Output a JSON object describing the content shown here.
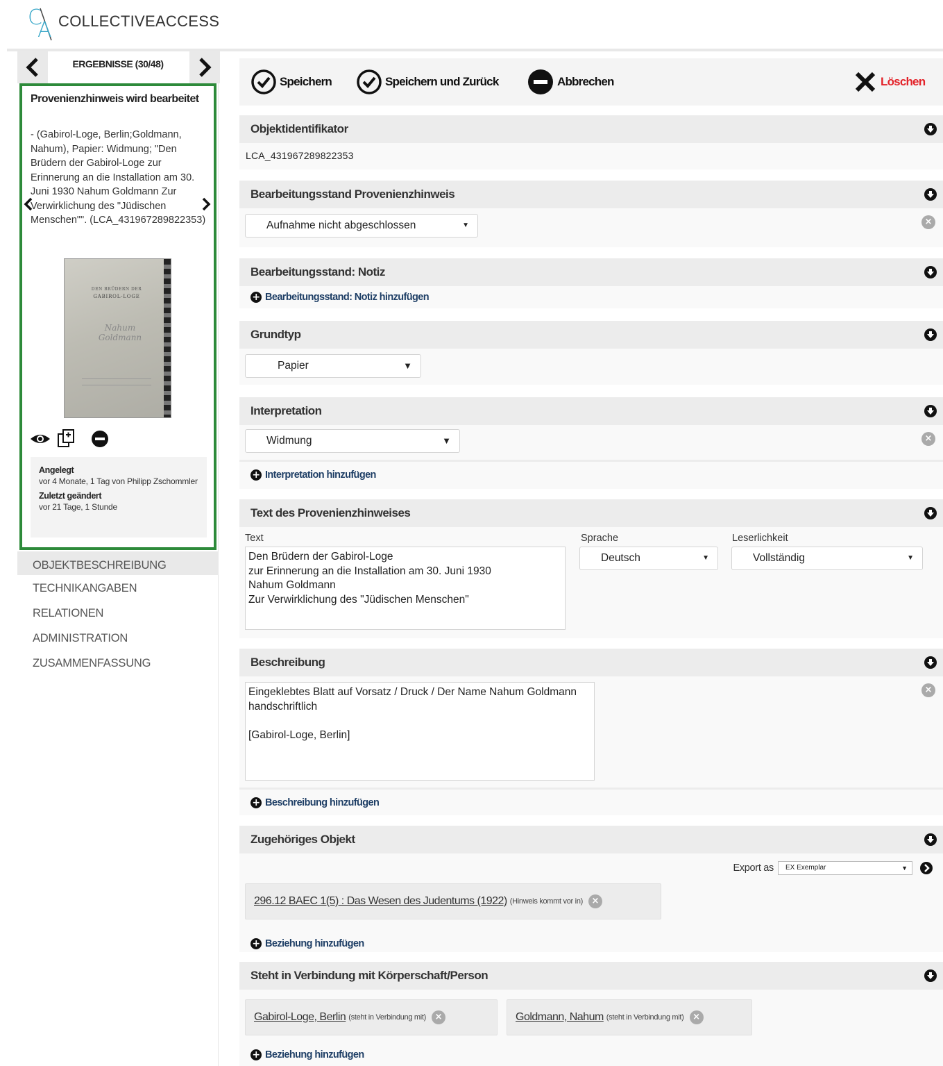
{
  "app": {
    "logo_text": "COLLECTIVEACCESS",
    "logo_c": "C",
    "logo_a": "A",
    "accent_color": "#3aa8c9"
  },
  "results": {
    "label": "ERGEBNISSE (30/48)",
    "prev_icon": "chevron-left-icon",
    "next_icon": "chevron-right-icon"
  },
  "inspector": {
    "title": "Provenienzhinweis wird bearbeitet",
    "description": "- (Gabirol-Loge, Berlin;Goldmann, Nahum), Papier: Widmung; \"Den Brüdern der Gabirol-Loge zur Erinnerung an die Installation am 30. Juni 1930 Nahum Goldmann Zur Verwirklichung des \"Jüdischen Menschen\"\". (LCA_431967289822353)",
    "border_color": "#2d8a3a",
    "thumbnail": {
      "line1": "DEN BRÜDERN DER",
      "line2": "GABIROL-LOGE",
      "signature": "Nahum Goldmann"
    },
    "created_label": "Angelegt",
    "created_value": "vor 4 Monate, 1 Tag von Philipp Zschommler",
    "modified_label": "Zuletzt geändert",
    "modified_value": "vor 21 Tage, 1 Stunde"
  },
  "side_menu": [
    {
      "label": "OBJEKTBESCHREIBUNG",
      "active": true
    },
    {
      "label": "TECHNIKANGABEN",
      "active": false
    },
    {
      "label": "RELATIONEN",
      "active": false
    },
    {
      "label": "ADMINISTRATION",
      "active": false
    },
    {
      "label": "ZUSAMMENFASSUNG",
      "active": false
    }
  ],
  "toolbar": {
    "save": "Speichern",
    "save_return": "Speichern und Zurück",
    "cancel": "Abbrechen",
    "delete": "Löschen",
    "delete_color": "#e3232a"
  },
  "sections": {
    "identifier": {
      "title": "Objektidentifikator",
      "value": "LCA_431967289822353"
    },
    "status": {
      "title": "Bearbeitungsstand Provenienzhinweis",
      "selected": "Aufnahme nicht abgeschlossen"
    },
    "status_note": {
      "title": "Bearbeitungsstand: Notiz",
      "add_label": "Bearbeitungsstand: Notiz hinzufügen"
    },
    "basic_type": {
      "title": "Grundtyp",
      "selected": "Papier"
    },
    "interpretation": {
      "title": "Interpretation",
      "selected": "Widmung",
      "add_label": "Interpretation hinzufügen"
    },
    "text": {
      "title": "Text des Provenienzhinweises",
      "text_label": "Text",
      "text_value": "Den Brüdern der Gabirol-Loge\nzur Erinnerung an die Installation am 30. Juni 1930\nNahum Goldmann\nZur Verwirklichung des \"Jüdischen Menschen\"",
      "language_label": "Sprache",
      "language_value": "Deutsch",
      "legibility_label": "Leserlichkeit",
      "legibility_value": "Vollständig"
    },
    "description": {
      "title": "Beschreibung",
      "value": "Eingeklebtes Blatt auf Vorsatz / Druck / Der Name Nahum Goldmann handschriftlich\n\n[Gabirol-Loge, Berlin]",
      "add_label": "Beschreibung hinzufügen"
    },
    "related_object": {
      "title": "Zugehöriges Objekt",
      "export_label": "Export as",
      "export_value": "EX Exemplar",
      "item_link": "296.12 BAEC 1(5) : Das Wesen des Judentums (1922)",
      "item_rel": "(Hinweis kommt vor in)",
      "add_label": "Beziehung hinzufügen"
    },
    "entity": {
      "title": "Steht in Verbindung mit Körperschaft/Person",
      "items": [
        {
          "link": "Gabirol-Loge, Berlin",
          "rel": "(steht in Verbindung mit)"
        },
        {
          "link": "Goldmann, Nahum",
          "rel": "(steht in Verbindung mit)"
        }
      ],
      "add_label": "Beziehung hinzufügen"
    }
  }
}
